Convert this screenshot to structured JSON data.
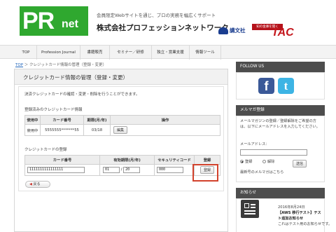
{
  "header": {
    "logo_main": "PR",
    "logo_sub": "net",
    "tagline": "会員限定Webサイトを通じ、プロの実務を幅広くサポート",
    "company": "株式会社プロフェッションネットワーク",
    "partner1": "講文社",
    "partner2_tag": "知の金庫を開く",
    "partner2": "TAC"
  },
  "nav": {
    "items": [
      "TOP",
      "Profession Journal",
      "書籍販売",
      "セミナー／研修",
      "独立・営業支援",
      "情報ツール"
    ]
  },
  "breadcrumb": {
    "top": "TOP",
    "sep": "＞",
    "current": "クレジットカード情報の管理（登録・変更）"
  },
  "main": {
    "title": "クレジットカード情報の管理（登録・変更）",
    "intro": "決済クレジットカードの確認・変更・削除を行うことができます。",
    "registered_heading": "登録済みのクレジットカード情報",
    "registered_table": {
      "headers": [
        "使用中",
        "カード番号",
        "期限(月/年)",
        "操作"
      ],
      "row": {
        "status": "使用中",
        "card_number": "5555555*******55",
        "expiry": "03/18",
        "action_label": "編集"
      }
    },
    "register_heading": "クレジットカードの登録",
    "register_table": {
      "headers": [
        "カード番号",
        "有効期限(月/年)",
        "セキュリティコード",
        "登録"
      ],
      "card_number_value": "1111111111111111",
      "month_value": "01",
      "slash": "/",
      "year_value": "20",
      "security_value": "000",
      "register_label": "登録"
    },
    "back_arrow": "◀",
    "back_label": "戻る"
  },
  "sidebar": {
    "follow_heading": "FOLLOW US",
    "facebook_glyph": "f",
    "twitter_glyph": "t",
    "mail_heading": "メルマガ登録",
    "mail_desc": "メールマガジンの登録／登録解除をご希望の方は、以下にメールアドレスを入力してください。",
    "email_label": "メールアドレス：",
    "email_value": "",
    "radio_register": "登録",
    "radio_unsubscribe": "解除",
    "send_label": "送信",
    "latest_link": "最新号のメルマガはこちら",
    "news_heading": "お知らせ",
    "news_date": "2016年8月24日",
    "news_title": "【AWS 移行テスト】テスト追加お知らせ",
    "news_body": "これはテスト用のお知らせです。"
  },
  "colors": {
    "brand_green": "#2fa82f",
    "highlight_red": "#d2422c",
    "sidebar_header": "#4d4d4d",
    "facebook": "#3b5998",
    "twitter": "#3db4e4"
  }
}
